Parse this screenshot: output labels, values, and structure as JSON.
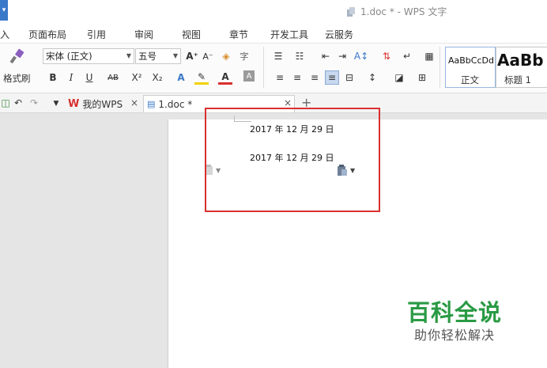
{
  "window": {
    "title": "1.doc * - WPS 文字"
  },
  "menu": {
    "tabs": [
      "入",
      "页面布局",
      "引用",
      "审阅",
      "视图",
      "章节",
      "开发工具",
      "云服务"
    ]
  },
  "ribbon": {
    "format_painter_label": "格式刷",
    "font_name": "宋体 (正文)",
    "font_size": "五号",
    "styles": [
      {
        "sample": "AaBbCcDd",
        "name": "正文"
      },
      {
        "sample": "AaBb",
        "name": "标题 1"
      }
    ]
  },
  "tabs": {
    "items": [
      {
        "label": "我的WPS"
      },
      {
        "label": "1.doc *"
      }
    ],
    "add_label": "+"
  },
  "document": {
    "lines": [
      "2017 年 12 月 29 日",
      "2017 年 12 月 29 日"
    ],
    "highlight_color": "#d8302f"
  },
  "watermark": {
    "title": "百科全说",
    "subtitle": "助你轻松解决"
  },
  "colors": {
    "wps_red": "#d8302f",
    "accent_blue": "#3a78c9",
    "watermark_green": "#2a9a44"
  }
}
